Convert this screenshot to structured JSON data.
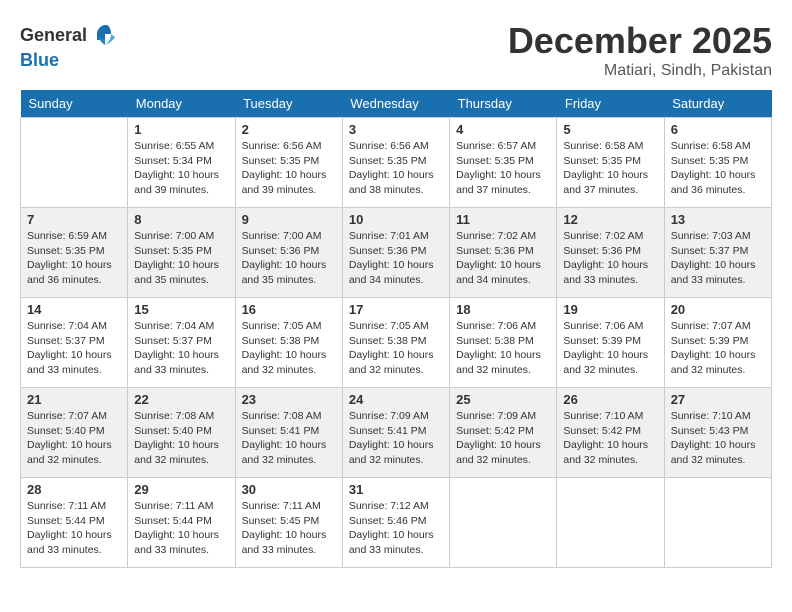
{
  "header": {
    "logo_general": "General",
    "logo_blue": "Blue",
    "month": "December 2025",
    "location": "Matiari, Sindh, Pakistan"
  },
  "days_of_week": [
    "Sunday",
    "Monday",
    "Tuesday",
    "Wednesday",
    "Thursday",
    "Friday",
    "Saturday"
  ],
  "weeks": [
    [
      {
        "day": "",
        "info": ""
      },
      {
        "day": "1",
        "info": "Sunrise: 6:55 AM\nSunset: 5:34 PM\nDaylight: 10 hours\nand 39 minutes."
      },
      {
        "day": "2",
        "info": "Sunrise: 6:56 AM\nSunset: 5:35 PM\nDaylight: 10 hours\nand 39 minutes."
      },
      {
        "day": "3",
        "info": "Sunrise: 6:56 AM\nSunset: 5:35 PM\nDaylight: 10 hours\nand 38 minutes."
      },
      {
        "day": "4",
        "info": "Sunrise: 6:57 AM\nSunset: 5:35 PM\nDaylight: 10 hours\nand 37 minutes."
      },
      {
        "day": "5",
        "info": "Sunrise: 6:58 AM\nSunset: 5:35 PM\nDaylight: 10 hours\nand 37 minutes."
      },
      {
        "day": "6",
        "info": "Sunrise: 6:58 AM\nSunset: 5:35 PM\nDaylight: 10 hours\nand 36 minutes."
      }
    ],
    [
      {
        "day": "7",
        "info": "Sunrise: 6:59 AM\nSunset: 5:35 PM\nDaylight: 10 hours\nand 36 minutes."
      },
      {
        "day": "8",
        "info": "Sunrise: 7:00 AM\nSunset: 5:35 PM\nDaylight: 10 hours\nand 35 minutes."
      },
      {
        "day": "9",
        "info": "Sunrise: 7:00 AM\nSunset: 5:36 PM\nDaylight: 10 hours\nand 35 minutes."
      },
      {
        "day": "10",
        "info": "Sunrise: 7:01 AM\nSunset: 5:36 PM\nDaylight: 10 hours\nand 34 minutes."
      },
      {
        "day": "11",
        "info": "Sunrise: 7:02 AM\nSunset: 5:36 PM\nDaylight: 10 hours\nand 34 minutes."
      },
      {
        "day": "12",
        "info": "Sunrise: 7:02 AM\nSunset: 5:36 PM\nDaylight: 10 hours\nand 33 minutes."
      },
      {
        "day": "13",
        "info": "Sunrise: 7:03 AM\nSunset: 5:37 PM\nDaylight: 10 hours\nand 33 minutes."
      }
    ],
    [
      {
        "day": "14",
        "info": "Sunrise: 7:04 AM\nSunset: 5:37 PM\nDaylight: 10 hours\nand 33 minutes."
      },
      {
        "day": "15",
        "info": "Sunrise: 7:04 AM\nSunset: 5:37 PM\nDaylight: 10 hours\nand 33 minutes."
      },
      {
        "day": "16",
        "info": "Sunrise: 7:05 AM\nSunset: 5:38 PM\nDaylight: 10 hours\nand 32 minutes."
      },
      {
        "day": "17",
        "info": "Sunrise: 7:05 AM\nSunset: 5:38 PM\nDaylight: 10 hours\nand 32 minutes."
      },
      {
        "day": "18",
        "info": "Sunrise: 7:06 AM\nSunset: 5:38 PM\nDaylight: 10 hours\nand 32 minutes."
      },
      {
        "day": "19",
        "info": "Sunrise: 7:06 AM\nSunset: 5:39 PM\nDaylight: 10 hours\nand 32 minutes."
      },
      {
        "day": "20",
        "info": "Sunrise: 7:07 AM\nSunset: 5:39 PM\nDaylight: 10 hours\nand 32 minutes."
      }
    ],
    [
      {
        "day": "21",
        "info": "Sunrise: 7:07 AM\nSunset: 5:40 PM\nDaylight: 10 hours\nand 32 minutes."
      },
      {
        "day": "22",
        "info": "Sunrise: 7:08 AM\nSunset: 5:40 PM\nDaylight: 10 hours\nand 32 minutes."
      },
      {
        "day": "23",
        "info": "Sunrise: 7:08 AM\nSunset: 5:41 PM\nDaylight: 10 hours\nand 32 minutes."
      },
      {
        "day": "24",
        "info": "Sunrise: 7:09 AM\nSunset: 5:41 PM\nDaylight: 10 hours\nand 32 minutes."
      },
      {
        "day": "25",
        "info": "Sunrise: 7:09 AM\nSunset: 5:42 PM\nDaylight: 10 hours\nand 32 minutes."
      },
      {
        "day": "26",
        "info": "Sunrise: 7:10 AM\nSunset: 5:42 PM\nDaylight: 10 hours\nand 32 minutes."
      },
      {
        "day": "27",
        "info": "Sunrise: 7:10 AM\nSunset: 5:43 PM\nDaylight: 10 hours\nand 32 minutes."
      }
    ],
    [
      {
        "day": "28",
        "info": "Sunrise: 7:11 AM\nSunset: 5:44 PM\nDaylight: 10 hours\nand 33 minutes."
      },
      {
        "day": "29",
        "info": "Sunrise: 7:11 AM\nSunset: 5:44 PM\nDaylight: 10 hours\nand 33 minutes."
      },
      {
        "day": "30",
        "info": "Sunrise: 7:11 AM\nSunset: 5:45 PM\nDaylight: 10 hours\nand 33 minutes."
      },
      {
        "day": "31",
        "info": "Sunrise: 7:12 AM\nSunset: 5:46 PM\nDaylight: 10 hours\nand 33 minutes."
      },
      {
        "day": "",
        "info": ""
      },
      {
        "day": "",
        "info": ""
      },
      {
        "day": "",
        "info": ""
      }
    ]
  ]
}
